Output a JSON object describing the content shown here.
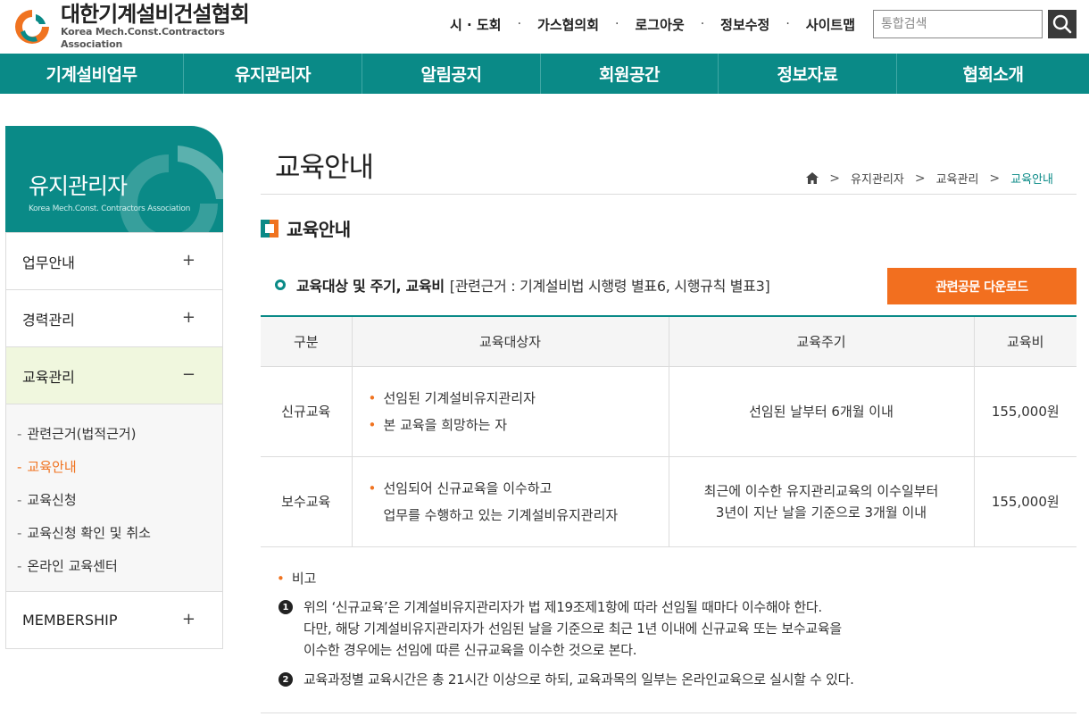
{
  "header": {
    "logo_ko": "대한기계설비건설협회",
    "logo_en": "Korea Mech.Const.Contractors Association",
    "util_links": [
      "시 · 도회",
      "가스협의회",
      "로그아웃",
      "정보수정",
      "사이트맵"
    ],
    "util_separator": "·",
    "search_placeholder": "통합검색"
  },
  "gnb": {
    "items": [
      "기계설비업무",
      "유지관리자",
      "알림공지",
      "회원공간",
      "정보자료",
      "협회소개"
    ]
  },
  "sidebar": {
    "title": "유지관리자",
    "subtitle": "Korea Mech.Const. Contractors Association",
    "items": [
      {
        "label": "업무안내",
        "toggle": "+"
      },
      {
        "label": "경력관리",
        "toggle": "+"
      },
      {
        "label": "교육관리",
        "toggle": "−"
      }
    ],
    "subitems": [
      "관련근거(법적근거)",
      "교육안내",
      "교육신청",
      "교육신청 확인 및 취소",
      "온라인 교육센터"
    ],
    "dash": "-",
    "last_item": {
      "label": "MEMBERSHIP",
      "toggle": "+"
    }
  },
  "content": {
    "page_title": "교육안내",
    "breadcrumb": [
      "유지관리자",
      "교육관리",
      "교육안내"
    ],
    "breadcrumb_sep": ">",
    "section_title": "교육안내",
    "sub_heading": "교육대상 및 주기, 교육비",
    "sub_heading_ref": "[관련근거 : 기계설비법 시행령 별표6, 시행규칙 별표3]",
    "download_button": "관련공문 다운로드",
    "table": {
      "headers": [
        "구분",
        "교육대상자",
        "교육주기",
        "교육비"
      ],
      "rows": [
        {
          "type": "신규교육",
          "targets": [
            "선임된 기계설비유지관리자",
            "본 교육을 희망하는 자"
          ],
          "cycle_lines": [
            "선임된 날부터 6개월 이내"
          ],
          "fee": "155,000원"
        },
        {
          "type": "보수교육",
          "targets": [
            "선임되어 신규교육을 이수하고",
            "업무를 수행하고 있는 기계설비유지관리자"
          ],
          "cycle_lines": [
            "최근에 이수한 유지관리교육의 이수일부터",
            "3년이 지난 날을 기준으로 3개월 이내"
          ],
          "fee": "155,000원"
        }
      ]
    },
    "notes": {
      "heading": "비고",
      "bullet": "•",
      "items": [
        {
          "num": "1",
          "lines": [
            "위의 ‘신규교육’은 기계설비유지관리자가 법 제19조제1항에 따라 선임될 때마다 이수해야 한다.",
            "다만, 해당 기계설비유지관리자가 선임된 날을 기준으로 최근 1년 이내에 신규교육 또는 보수교육을",
            "이수한 경우에는 선임에 따른 신규교육을 이수한 것으로 본다."
          ]
        },
        {
          "num": "2",
          "lines": [
            "교육과정별 교육시간은 총 21시간 이상으로 하되, 교육과목의 일부는 온라인교육으로 실시할 수 있다."
          ]
        }
      ]
    }
  },
  "colors": {
    "teal": "#0a8a87",
    "orange": "#f26f1f",
    "active_bg": "#f0f7de"
  }
}
